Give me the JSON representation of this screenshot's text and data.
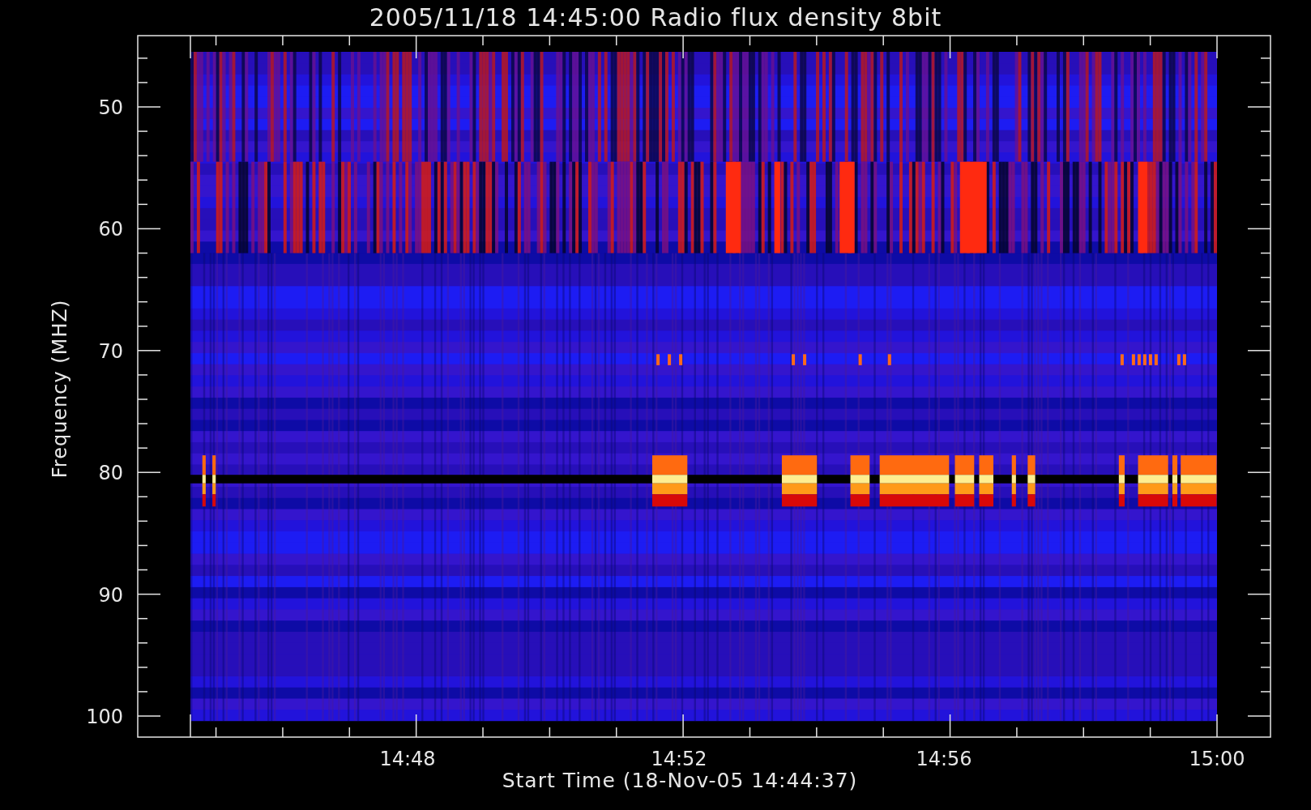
{
  "title": "2005/11/18 14:45:00 Radio flux density 8bit",
  "plot": {
    "ylabel": "Frequency (MHZ)",
    "xlabel": "Start Time (18-Nov-05 14:44:37)",
    "yticks": [
      "50",
      "60",
      "70",
      "80",
      "90",
      "100"
    ],
    "xticks": [
      "14:48",
      "14:52",
      "14:56",
      "15:00"
    ]
  }
}
